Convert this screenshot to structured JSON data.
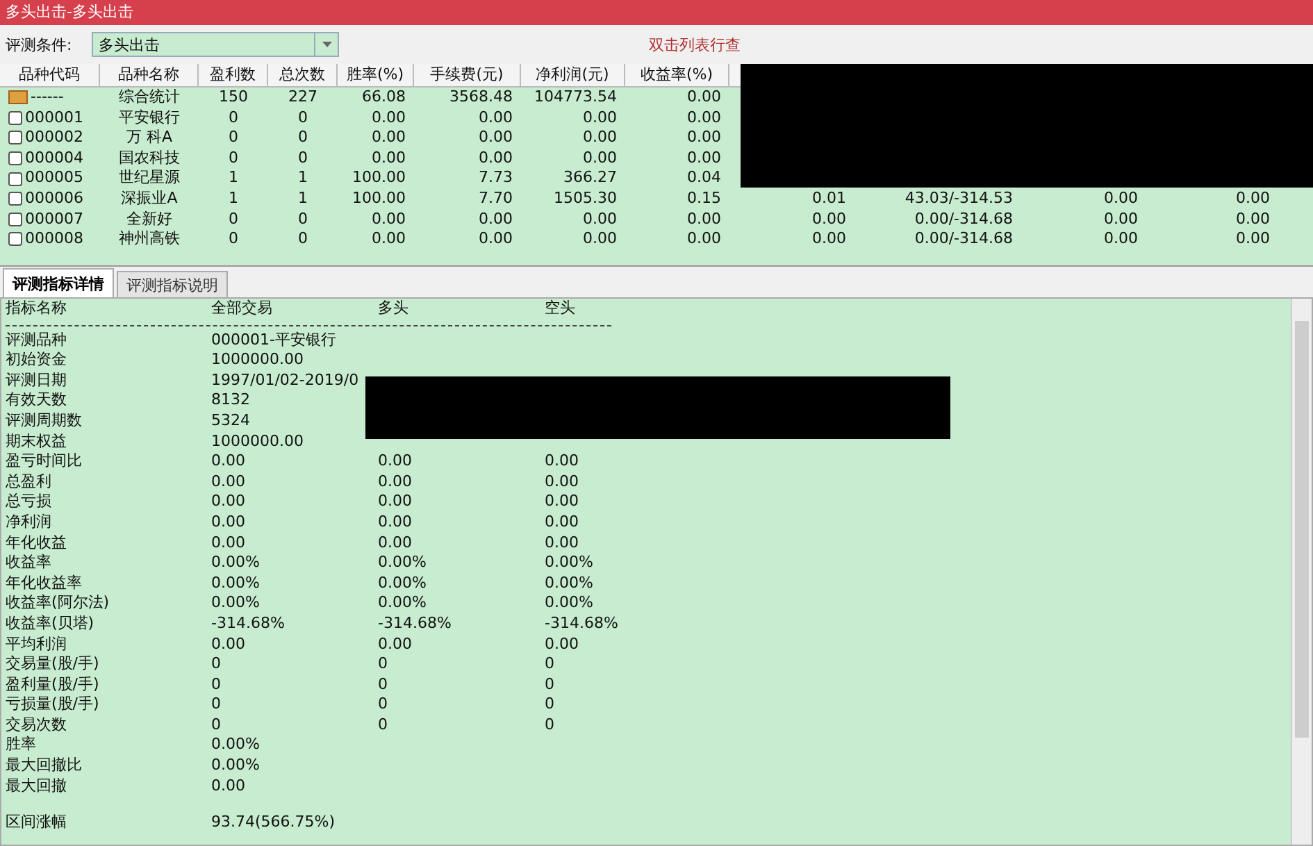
{
  "window": {
    "title": "多头出击-多头出击"
  },
  "condition": {
    "label": "评测条件:",
    "value": "多头出击",
    "hint": "双击列表行查"
  },
  "table": {
    "columns": [
      "品种代码",
      "品种名称",
      "盈利数",
      "总次数",
      "胜率(%)",
      "手续费(元)",
      "净利润(元)",
      "收益率(%)"
    ],
    "rows": [
      {
        "kind": "summary",
        "cells": [
          "------",
          "综合统计",
          "150",
          "227",
          "66.08",
          "3568.48",
          "104773.54",
          "0.00"
        ]
      },
      {
        "kind": "item",
        "cells": [
          "000001",
          "平安银行",
          "0",
          "0",
          "0.00",
          "0.00",
          "0.00",
          "0.00"
        ]
      },
      {
        "kind": "item",
        "cells": [
          "000002",
          "万 科A",
          "0",
          "0",
          "0.00",
          "0.00",
          "0.00",
          "0.00"
        ]
      },
      {
        "kind": "item",
        "cells": [
          "000004",
          "国农科技",
          "0",
          "0",
          "0.00",
          "0.00",
          "0.00",
          "0.00"
        ]
      },
      {
        "kind": "item",
        "cells": [
          "000005",
          "世纪星源",
          "1",
          "1",
          "100.00",
          "7.73",
          "366.27",
          "0.04"
        ]
      },
      {
        "kind": "item",
        "cells": [
          "000006",
          "深振业A",
          "1",
          "1",
          "100.00",
          "7.70",
          "1505.30",
          "0.15"
        ],
        "extra": [
          "0.01",
          "43.03/-314.53",
          "0.00",
          "0.00"
        ]
      },
      {
        "kind": "item",
        "cells": [
          "000007",
          "全新好",
          "0",
          "0",
          "0.00",
          "0.00",
          "0.00",
          "0.00"
        ],
        "extra": [
          "0.00",
          "0.00/-314.68",
          "0.00",
          "0.00"
        ]
      },
      {
        "kind": "item",
        "cells": [
          "000008",
          "神州高铁",
          "0",
          "0",
          "0.00",
          "0.00",
          "0.00",
          "0.00"
        ],
        "extra": [
          "0.00",
          "0.00/-314.68",
          "0.00",
          "0.00"
        ]
      }
    ]
  },
  "tabs": [
    {
      "label": "评测指标详情",
      "selected": true
    },
    {
      "label": "评测指标说明",
      "selected": false
    }
  ],
  "detail": {
    "columns": [
      "指标名称",
      "全部交易",
      "多头",
      "空头"
    ],
    "rows": [
      {
        "label": "评测品种",
        "values": [
          "000001-平安银行"
        ]
      },
      {
        "label": "初始资金",
        "values": [
          "1000000.00"
        ]
      },
      {
        "label": "评测日期",
        "values": [
          "1997/01/02-2019/0"
        ]
      },
      {
        "label": "有效天数",
        "values": [
          "8132"
        ]
      },
      {
        "label": "评测周期数",
        "values": [
          "5324"
        ]
      },
      {
        "label": "期末权益",
        "values": [
          "1000000.00"
        ]
      },
      {
        "label": "盈亏时间比",
        "values": [
          "0.00",
          "0.00",
          "0.00"
        ]
      },
      {
        "label": "总盈利",
        "values": [
          "0.00",
          "0.00",
          "0.00"
        ]
      },
      {
        "label": "总亏损",
        "values": [
          "0.00",
          "0.00",
          "0.00"
        ]
      },
      {
        "label": "净利润",
        "values": [
          "0.00",
          "0.00",
          "0.00"
        ]
      },
      {
        "label": "年化收益",
        "values": [
          "0.00",
          "0.00",
          "0.00"
        ]
      },
      {
        "label": "收益率",
        "values": [
          "0.00%",
          "0.00%",
          "0.00%"
        ]
      },
      {
        "label": "年化收益率",
        "values": [
          "0.00%",
          "0.00%",
          "0.00%"
        ]
      },
      {
        "label": "收益率(阿尔法)",
        "values": [
          "0.00%",
          "0.00%",
          "0.00%"
        ]
      },
      {
        "label": "收益率(贝塔)",
        "values": [
          "-314.68%",
          "-314.68%",
          "-314.68%"
        ]
      },
      {
        "label": "平均利润",
        "values": [
          "0.00",
          "0.00",
          "0.00"
        ]
      },
      {
        "label": "交易量(股/手)",
        "values": [
          "0",
          "0",
          "0"
        ]
      },
      {
        "label": "盈利量(股/手)",
        "values": [
          "0",
          "0",
          "0"
        ]
      },
      {
        "label": "亏损量(股/手)",
        "values": [
          "0",
          "0",
          "0"
        ]
      },
      {
        "label": "交易次数",
        "values": [
          "0",
          "0",
          "0"
        ]
      },
      {
        "label": "胜率",
        "values": [
          "0.00%"
        ]
      },
      {
        "label": "最大回撤比",
        "values": [
          "0.00%"
        ]
      },
      {
        "label": "最大回撤",
        "values": [
          "0.00"
        ]
      }
    ],
    "footer": {
      "label": "区间涨幅",
      "value": "93.74(566.75%)"
    }
  }
}
